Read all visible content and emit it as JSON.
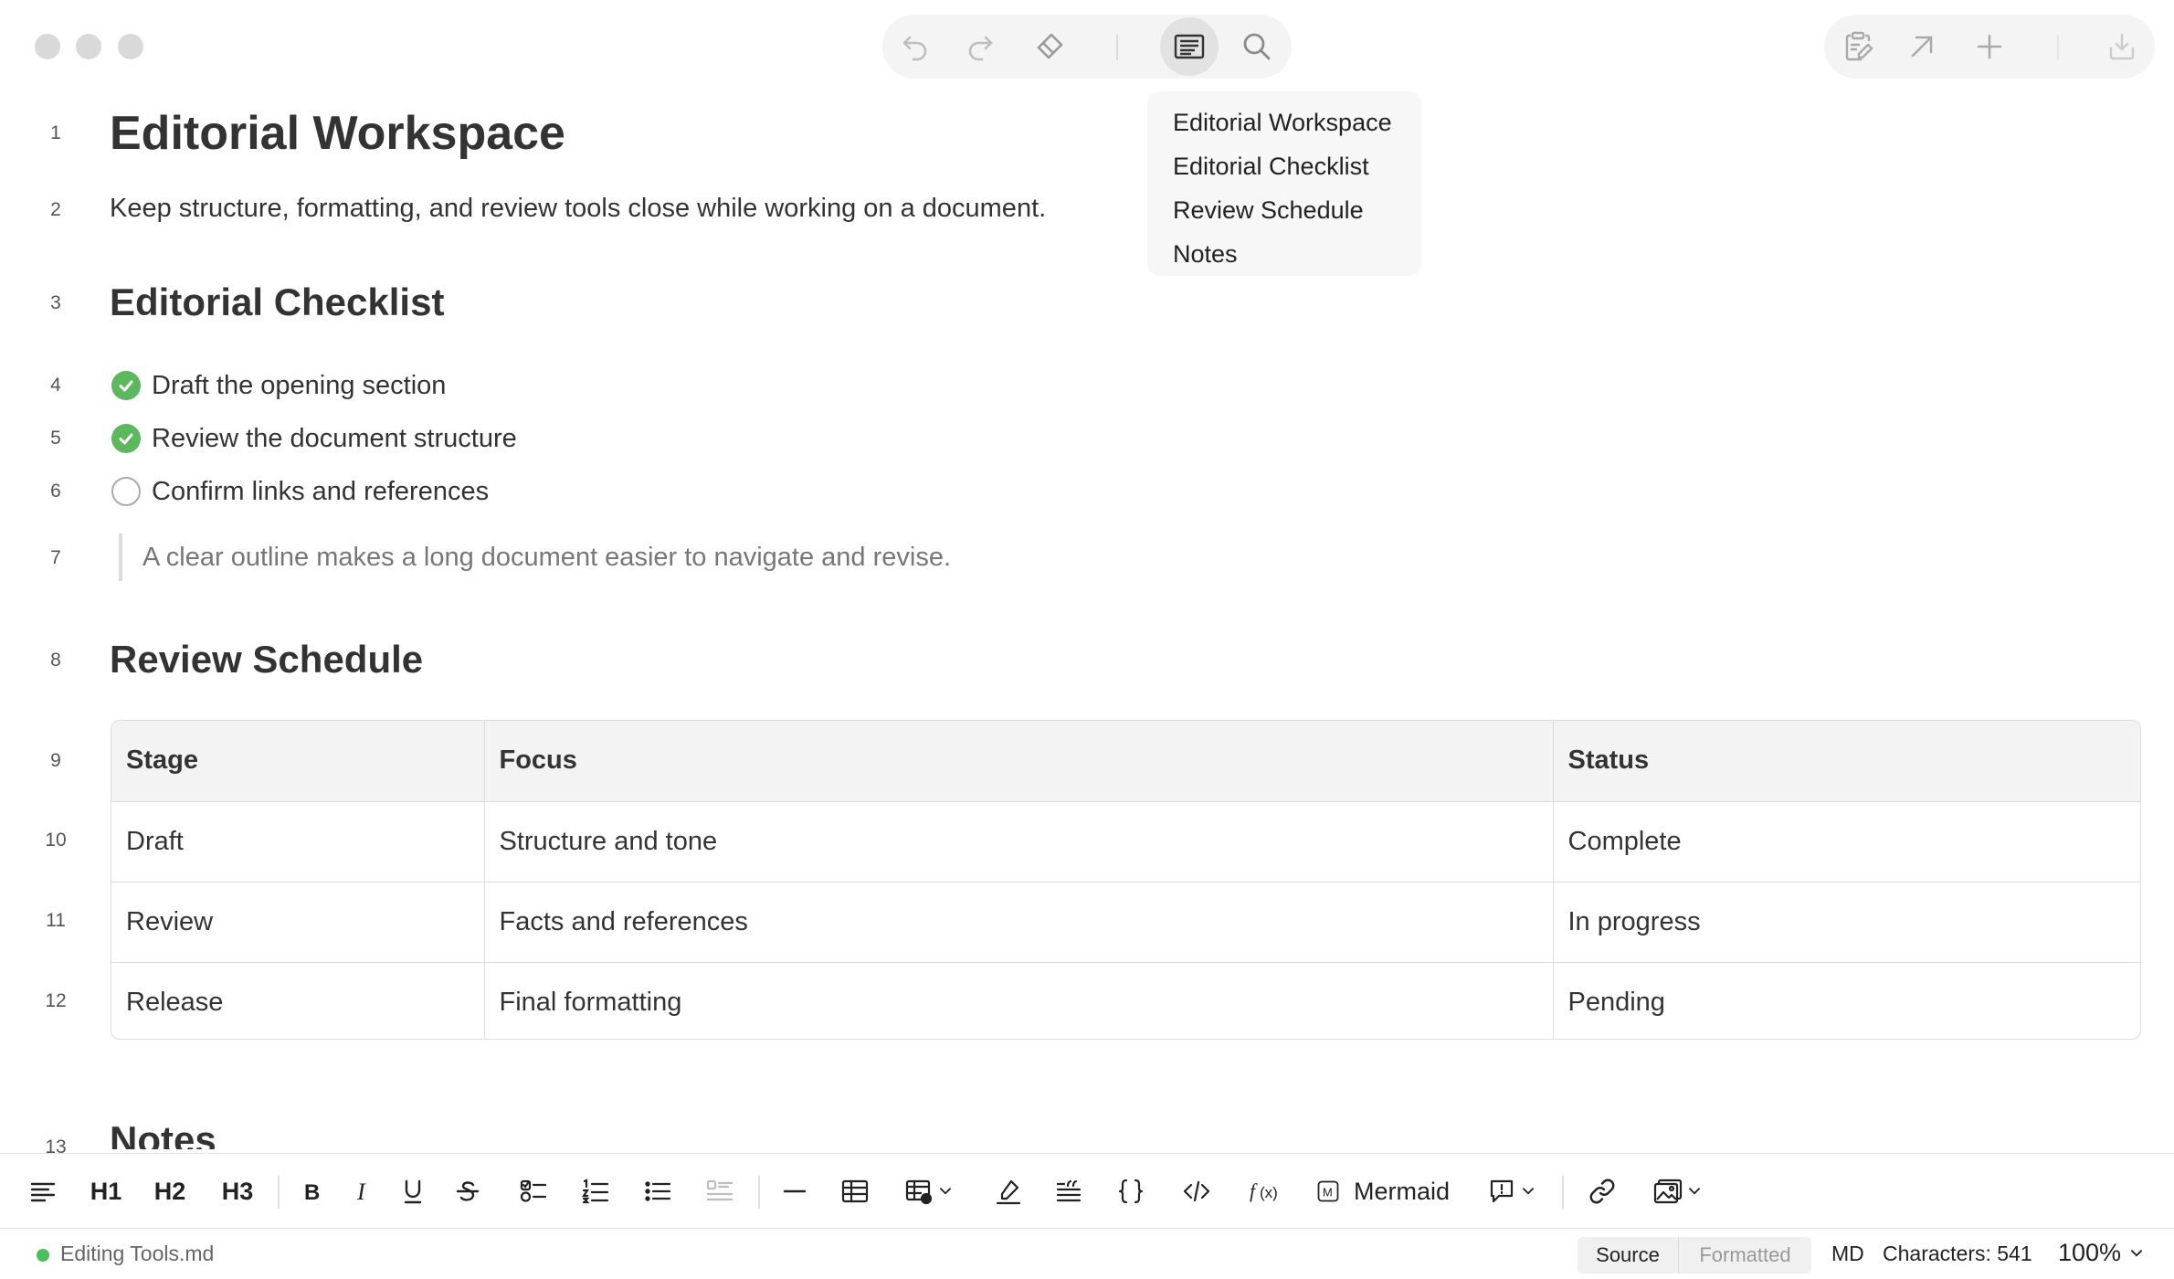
{
  "window": {
    "file_name": "Editing Tools.md",
    "traffic_lights": [
      "close",
      "minimize",
      "zoom"
    ]
  },
  "toolbar": {
    "history": [
      "undo-icon",
      "redo-icon",
      "eraser-icon"
    ],
    "view": [
      "outline-icon",
      "search-icon"
    ],
    "right": [
      "clipboard-edit-icon",
      "open-external-icon",
      "plus-icon",
      "export-icon"
    ]
  },
  "outline": {
    "items": [
      "Editorial Workspace",
      "Editorial Checklist",
      "Review Schedule",
      "Notes"
    ]
  },
  "document": {
    "line_numbers": [
      "1",
      "2",
      "3",
      "4",
      "5",
      "6",
      "7",
      "8",
      "9",
      "10",
      "11",
      "12",
      "13"
    ],
    "title": "Editorial Workspace",
    "intro": "Keep structure, formatting, and review tools close while working on a document.",
    "checklist_heading": "Editorial Checklist",
    "tasks": [
      {
        "text": "Draft the opening section",
        "done": true
      },
      {
        "text": "Review the document structure",
        "done": true
      },
      {
        "text": "Confirm links and references",
        "done": false
      }
    ],
    "quote": "A clear outline makes a long document easier to navigate and revise.",
    "schedule_heading": "Review Schedule",
    "table": {
      "headers": [
        "Stage",
        "Focus",
        "Status"
      ],
      "rows": [
        [
          "Draft",
          "Structure and tone",
          "Complete"
        ],
        [
          "Review",
          "Facts and references",
          "In progress"
        ],
        [
          "Release",
          "Final formatting",
          "Pending"
        ]
      ]
    },
    "notes_heading": "Notes"
  },
  "format_toolbar": {
    "h1": "H1",
    "h2": "H2",
    "h3": "H3",
    "mermaid": "Mermaid"
  },
  "status": {
    "mode_source": "Source",
    "mode_formatted": "Formatted",
    "format": "MD",
    "characters": "Characters: 541",
    "zoom": "100%"
  },
  "colors": {
    "task_done": "#5cb85c",
    "status_dot": "#4cbf5a"
  }
}
